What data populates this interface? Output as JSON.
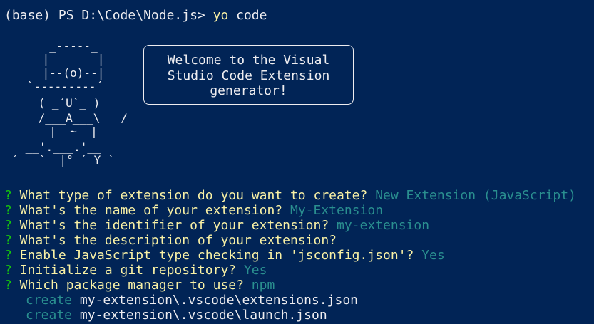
{
  "prompt": {
    "text": "(base) PS D:\\Code\\Node.js> ",
    "command": "yo",
    "argument": " code"
  },
  "banner": {
    "art_rows": [
      "  _-----_     ",
      " |       |    ",
      " |--(o)--|    ",
      "`---------´   ",
      " ( _´U`_ )    ",
      " /___A___\\   /",
      "  |  ~  |     ",
      " __'.___.'__   ",
      "´   `  |° ´ Y `"
    ],
    "welcome_text": "Welcome to the Visual\nStudio Code Extension\ngenerator!"
  },
  "questions": [
    {
      "mark": "?",
      "question": " What type of extension do you want to create? ",
      "answer": "New Extension (JavaScript)"
    },
    {
      "mark": "?",
      "question": " What's the name of your extension? ",
      "answer": "My-Extension"
    },
    {
      "mark": "?",
      "question": " What's the identifier of your extension? ",
      "answer": "my-extension"
    },
    {
      "mark": "?",
      "question": " What's the description of your extension? ",
      "answer": ""
    },
    {
      "mark": "?",
      "question": " Enable JavaScript type checking in 'jsconfig.json'? ",
      "answer": "Yes"
    },
    {
      "mark": "?",
      "question": " Initialize a git repository? ",
      "answer": "Yes"
    },
    {
      "mark": "?",
      "question": " Which package manager to use? ",
      "answer": "npm"
    }
  ],
  "created_files": [
    {
      "action": "create",
      "path": " my-extension\\.vscode\\extensions.json"
    },
    {
      "action": "create",
      "path": " my-extension\\.vscode\\launch.json"
    }
  ],
  "colors": {
    "background": "#012456",
    "foreground": "#eeedf0",
    "command_yellow": "#f9f1a5",
    "question_green": "#16c60c",
    "answer_cyan": "#2a8f8f",
    "art_red": "#c50f1f"
  }
}
